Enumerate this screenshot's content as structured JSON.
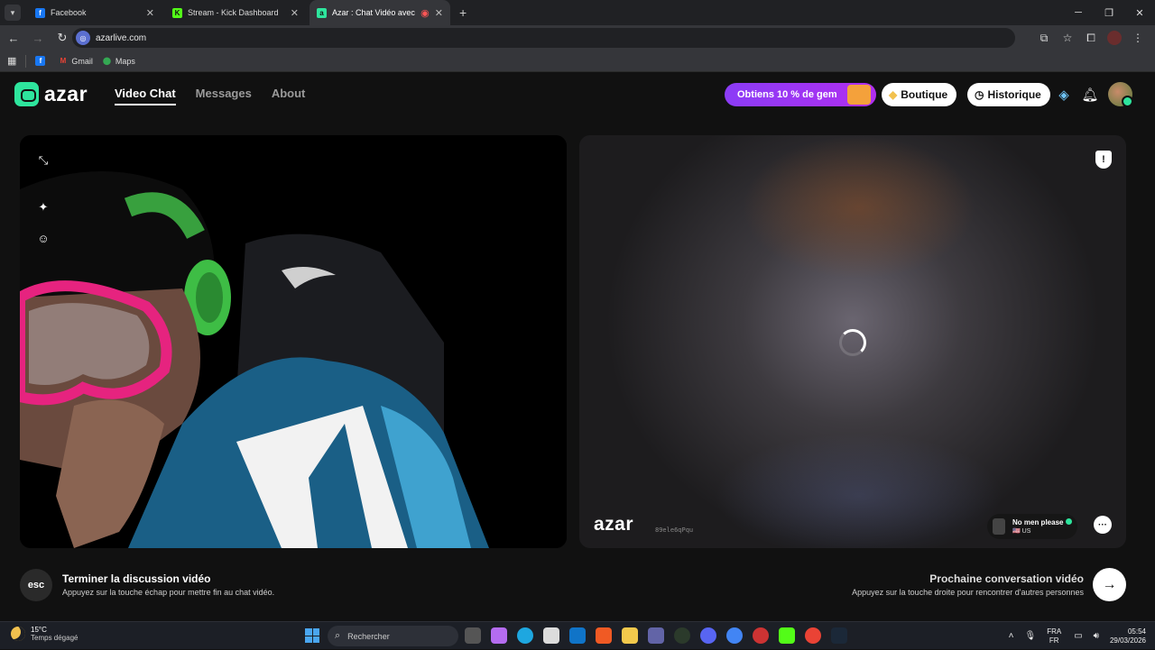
{
  "browser": {
    "tabs": [
      {
        "label": "Facebook",
        "active": false,
        "icon": "facebook-icon",
        "color": "#1877f2"
      },
      {
        "label": "Stream - Kick Dashboard",
        "active": false,
        "icon": "kick-icon",
        "color": "#53fc18"
      },
      {
        "label": "Azar : Chat Vidéo avec de n",
        "active": true,
        "icon": "azar-icon",
        "color": "#2ee59d"
      }
    ],
    "url": "azarlive.com",
    "bookmarks": [
      {
        "label": "",
        "icon": "facebook-icon"
      },
      {
        "label": "Gmail",
        "icon": "gmail-icon"
      },
      {
        "label": "Maps",
        "icon": "maps-icon"
      }
    ]
  },
  "header": {
    "logo_text": "azar",
    "nav": [
      {
        "label": "Video Chat",
        "active": true
      },
      {
        "label": "Messages",
        "active": false
      },
      {
        "label": "About",
        "active": false
      }
    ],
    "promo_text": "Obtiens 10 % de gem",
    "shop_label": "Boutique",
    "history_label": "Historique"
  },
  "partner": {
    "watermark": "azar",
    "session_id": "89ele6qPqu",
    "name": "No men please",
    "country": "US"
  },
  "footer": {
    "esc_label": "esc",
    "end_title": "Terminer la discussion vidéo",
    "end_sub": "Appuyez sur la touche échap pour mettre fin au chat vidéo.",
    "next_title": "Prochaine conversation vidéo",
    "next_sub": "Appuyez sur la touche droite pour rencontrer d'autres personnes"
  },
  "taskbar": {
    "temperature": "15°C",
    "weather": "Temps dégagé",
    "search_placeholder": "Rechercher",
    "lang_top": "FRA",
    "lang_bottom": "FR",
    "time": "05:54",
    "date": "29/03/2026"
  },
  "colors": {
    "accent": "#2ee59d",
    "promo": "#8b3cf6",
    "background": "#111111"
  }
}
